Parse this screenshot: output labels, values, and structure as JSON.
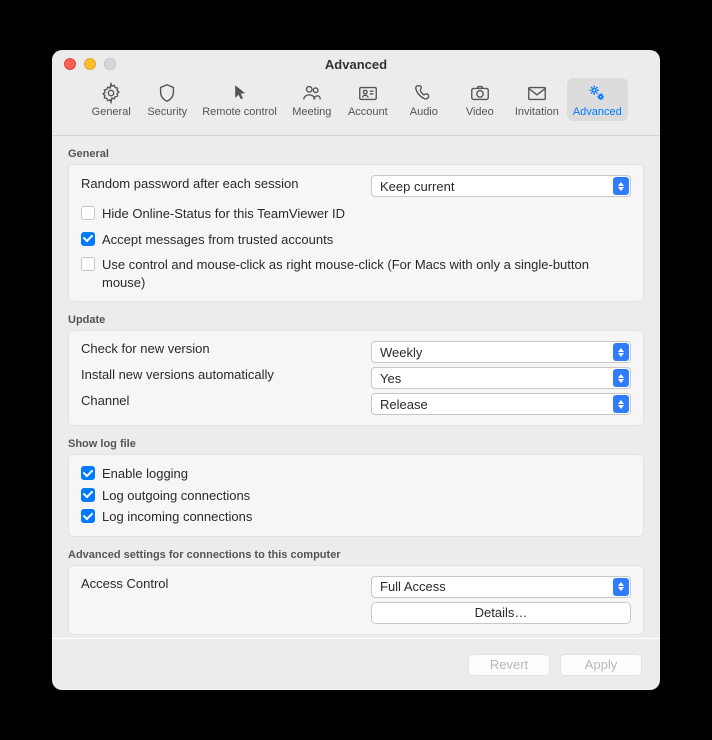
{
  "window": {
    "title": "Advanced"
  },
  "tabs": [
    {
      "label": "General"
    },
    {
      "label": "Security"
    },
    {
      "label": "Remote control"
    },
    {
      "label": "Meeting"
    },
    {
      "label": "Account"
    },
    {
      "label": "Audio"
    },
    {
      "label": "Video"
    },
    {
      "label": "Invitation"
    },
    {
      "label": "Advanced"
    }
  ],
  "general": {
    "head": "General",
    "random_pw_label": "Random password after each session",
    "random_pw_value": "Keep current",
    "hide_online": "Hide Online-Status for this TeamViewer ID",
    "accept_trusted": "Accept messages from trusted accounts",
    "right_click": "Use control and mouse-click as right mouse-click (For Macs with only a single-button mouse)"
  },
  "update": {
    "head": "Update",
    "check_label": "Check for new version",
    "check_value": "Weekly",
    "install_label": "Install new versions automatically",
    "install_value": "Yes",
    "channel_label": "Channel",
    "channel_value": "Release"
  },
  "log": {
    "head": "Show log file",
    "enable": "Enable logging",
    "outgoing": "Log outgoing connections",
    "incoming": "Log incoming connections"
  },
  "advconn": {
    "head": "Advanced settings for connections to this computer",
    "access_label": "Access Control",
    "access_value": "Full Access",
    "details": "Details…"
  },
  "footer": {
    "revert": "Revert",
    "apply": "Apply"
  }
}
